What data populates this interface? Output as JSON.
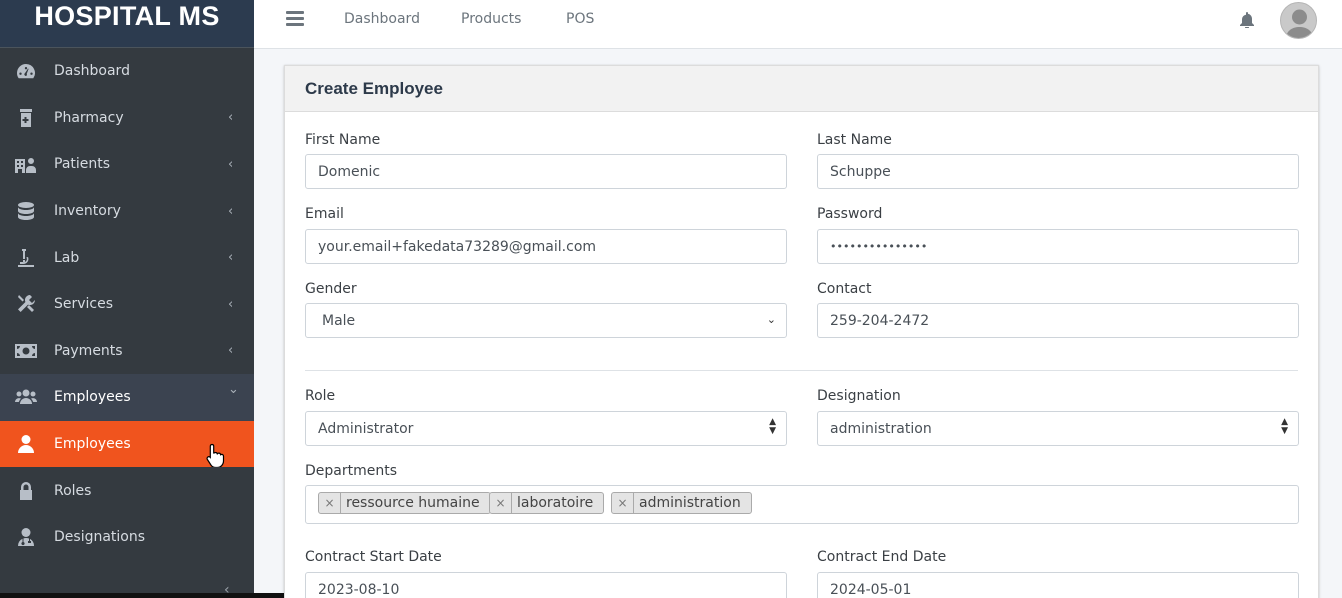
{
  "app": {
    "brand": "HOSPITAL MS"
  },
  "sidebar": {
    "items": [
      {
        "label": "Dashboard",
        "icon": "tachometer-icon",
        "chevron": ""
      },
      {
        "label": "Pharmacy",
        "icon": "pharmacy-icon",
        "chevron": "‹"
      },
      {
        "label": "Patients",
        "icon": "hospital-user-icon",
        "chevron": "‹"
      },
      {
        "label": "Inventory",
        "icon": "database-icon",
        "chevron": "‹"
      },
      {
        "label": "Lab",
        "icon": "microscope-icon",
        "chevron": "‹"
      },
      {
        "label": "Services",
        "icon": "tools-icon",
        "chevron": "‹"
      },
      {
        "label": "Payments",
        "icon": "money-bill-icon",
        "chevron": "‹"
      },
      {
        "label": "Employees",
        "icon": "users-icon",
        "chevron": "⌄"
      },
      {
        "label": "Employees",
        "icon": "user-icon",
        "chevron": ""
      },
      {
        "label": "Roles",
        "icon": "lock-icon",
        "chevron": ""
      },
      {
        "label": "Designations",
        "icon": "user-doctor-icon",
        "chevron": ""
      }
    ],
    "collapse": "‹"
  },
  "topbar": {
    "links": [
      "Dashboard",
      "Products",
      "POS"
    ]
  },
  "form": {
    "title": "Create Employee",
    "first_name": {
      "label": "First Name",
      "value": "Domenic"
    },
    "last_name": {
      "label": "Last Name",
      "value": "Schuppe"
    },
    "email": {
      "label": "Email",
      "value": "your.email+fakedata73289@gmail.com"
    },
    "password": {
      "label": "Password",
      "value": "•••••••••••••••"
    },
    "gender": {
      "label": "Gender",
      "value": "Male"
    },
    "contact": {
      "label": "Contact",
      "value": "259-204-2472"
    },
    "role": {
      "label": "Role",
      "value": "Administrator"
    },
    "designation": {
      "label": "Designation",
      "value": "administration"
    },
    "departments": {
      "label": "Departments",
      "tags": [
        "ressource humaine",
        "laboratoire",
        "administration"
      ],
      "remove": "×"
    },
    "contract_start": {
      "label": "Contract Start Date",
      "value": "2023-08-10"
    },
    "contract_end": {
      "label": "Contract End Date",
      "value": "2024-05-01"
    }
  },
  "colors": {
    "sidebar_bg": "#343a40",
    "active_item": "#f0541e",
    "brand_bg": "#2c3b4f"
  }
}
